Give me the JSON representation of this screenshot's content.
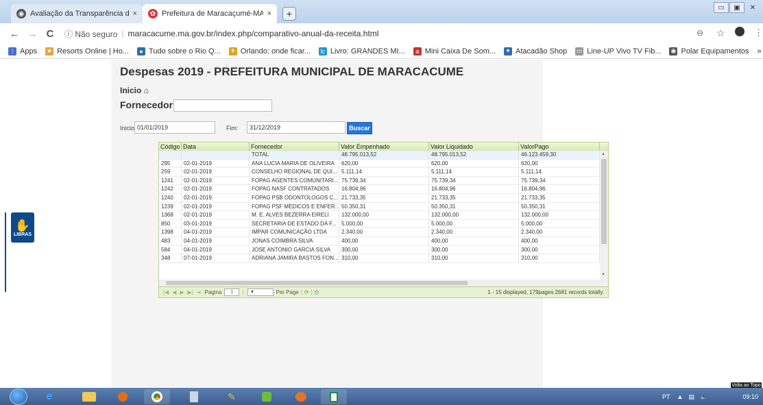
{
  "browser": {
    "tabs": [
      {
        "label": "Avaliação da Transparência dos",
        "close": "×"
      },
      {
        "label": "Prefeitura de Maracaçumé-MA -",
        "close": "×"
      }
    ],
    "new_tab": "+",
    "window_buttons": [
      "▭",
      "▣",
      "✕"
    ],
    "nav": {
      "back": "←",
      "forward": "→",
      "reload": "C"
    },
    "address": {
      "security": "ⓘ Não seguro",
      "url": "maracacume.ma.gov.br/index.php/comparativo-anual-da-receita.html"
    },
    "toolbar_icons": [
      "zoom-icon",
      "star-icon",
      "account-icon",
      "menu-icon"
    ],
    "bookmarks": [
      {
        "label": "Apps",
        "icon": "apps-icon",
        "color": "#4a6fd1"
      },
      {
        "label": "Resorts Online | Ho...",
        "icon": "star-icon",
        "color": "#e8a23a"
      },
      {
        "label": "Tudo sobre o Rio Q...",
        "icon": "leaf-icon",
        "color": "#2f6fa8"
      },
      {
        "label": "Orlando: onde ficar...",
        "icon": "plane-icon",
        "color": "#e0a21e"
      },
      {
        "label": "Livro: GRANDES MI...",
        "icon": "lc-icon",
        "color": "#1a9ad6"
      },
      {
        "label": "Mini Caixa De Som...",
        "icon": "shop-icon",
        "color": "#c0392b"
      },
      {
        "label": "Atacadão Shop",
        "icon": "cart-icon",
        "color": "#2e6db0"
      },
      {
        "label": "Line-UP Vivo TV Fib...",
        "icon": "tv-icon",
        "color": "#999999"
      },
      {
        "label": "Polar Equipamentos",
        "icon": "globe-icon",
        "color": "#555555"
      }
    ],
    "bookmarks_more": "»"
  },
  "page": {
    "title": "Despesas 2019 - PREFEITURA MUNICIPAL DE MARACACUME",
    "inicio": "Inicio",
    "fornecedor_label": "Fornecedor:",
    "fornecedor_value": "",
    "inicio_label": "Inicio:",
    "inicio_value": "01/01/2019",
    "fim_label": "Fim:",
    "fim_value": "31/12/2019",
    "buscar": "Buscar"
  },
  "grid": {
    "columns": [
      "Código",
      "Data",
      "Fornecedor",
      "Valor Empenhado",
      "Valor Liquidado",
      "ValorPago"
    ],
    "total": {
      "codigo": "",
      "data": "",
      "fornecedor": "TOTAL",
      "empenhado": "48.795.013,52",
      "liquidado": "48.795.013,52",
      "pago": "46.123.459,30"
    },
    "rows": [
      {
        "codigo": "295",
        "data": "02-01-2019",
        "fornecedor": "ANA LUCIA MARIA DE OLIVEIRA",
        "empenhado": "620,00",
        "liquidado": "620,00",
        "pago": "620,00"
      },
      {
        "codigo": "259",
        "data": "02-01-2019",
        "fornecedor": "CONSELHO REGIONAL DE QUI...",
        "empenhado": "5.111,14",
        "liquidado": "5.111,14",
        "pago": "5.111,14"
      },
      {
        "codigo": "1241",
        "data": "02-01-2019",
        "fornecedor": "FOPAG AGENTES COMUNITARI...",
        "empenhado": "75.739,34",
        "liquidado": "75.739,34",
        "pago": "75.739,34"
      },
      {
        "codigo": "1242",
        "data": "02-01-2019",
        "fornecedor": "FOPAG NASF CONTRATADOS",
        "empenhado": "16.804,96",
        "liquidado": "16.804,96",
        "pago": "16.804,96"
      },
      {
        "codigo": "1240",
        "data": "02-01-2019",
        "fornecedor": "FOPAG PSB ODONTOLOGOS C...",
        "empenhado": "21.733,35",
        "liquidado": "21.733,35",
        "pago": "21.733,35"
      },
      {
        "codigo": "1239",
        "data": "02-01-2019",
        "fornecedor": "FOPAG PSF MEDICOS E ENFER...",
        "empenhado": "50.350,31",
        "liquidado": "50.350,31",
        "pago": "50.350,31"
      },
      {
        "codigo": "1368",
        "data": "02-01-2019",
        "fornecedor": "M. E. ALVES BEZERRA EIRELI",
        "empenhado": "132.000,00",
        "liquidado": "132.000,00",
        "pago": "132.000,00"
      },
      {
        "codigo": "850",
        "data": "03-01-2019",
        "fornecedor": "SECRETARIA DE ESTADO DA F...",
        "empenhado": "5.000,00",
        "liquidado": "5.000,00",
        "pago": "5.000,00"
      },
      {
        "codigo": "1398",
        "data": "04-01-2019",
        "fornecedor": "IMPAR COMUNICAÇÃO LTDA",
        "empenhado": "2.340,00",
        "liquidado": "2.340,00",
        "pago": "2.340,00"
      },
      {
        "codigo": "483",
        "data": "04-01-2019",
        "fornecedor": "JONAS COIMBRA SILVA",
        "empenhado": "400,00",
        "liquidado": "400,00",
        "pago": "400,00"
      },
      {
        "codigo": "584",
        "data": "04-01-2019",
        "fornecedor": "JOSE ANTONIO GARCIA SILVA",
        "empenhado": "300,00",
        "liquidado": "300,00",
        "pago": "300,00"
      },
      {
        "codigo": "348",
        "data": "07-01-2019",
        "fornecedor": "ADRIANA JAMIRA BASTOS FON...",
        "empenhado": "310,00",
        "liquidado": "310,00",
        "pago": "310,00"
      }
    ],
    "pager": {
      "label": "Pagina",
      "page": "1",
      "per_page_label": "Per Page",
      "info": "1 - 15 displayed, 179pages 2681 records totally."
    }
  },
  "libras": "LIBRAS",
  "volta_topo": "Volta ao Topo",
  "taskbar": {
    "lang": "PT",
    "time": "09:10"
  }
}
